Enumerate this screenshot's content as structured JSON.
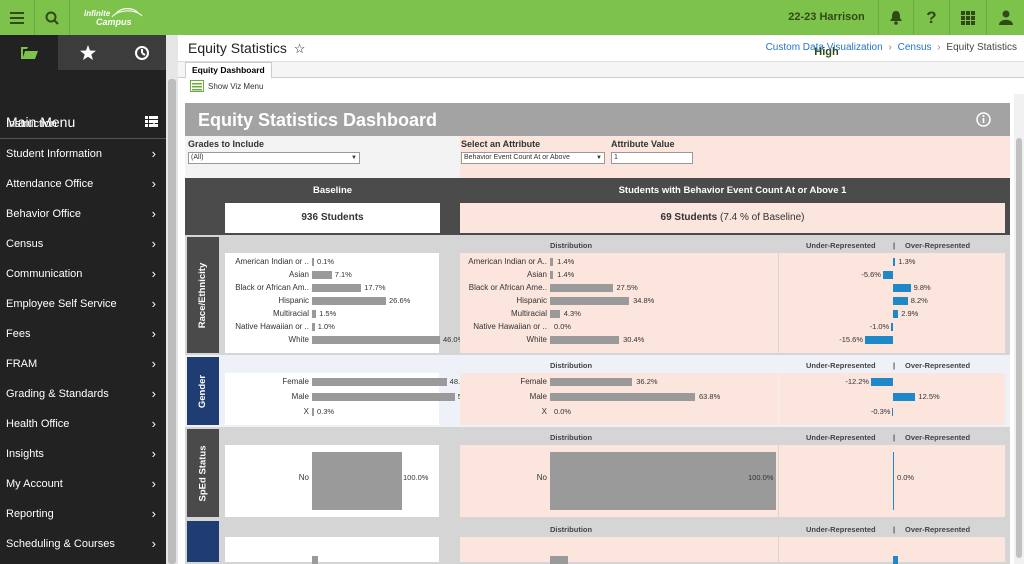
{
  "topbar": {
    "school": "22-23 Harrison High",
    "logo_line1": "Infinite",
    "logo_line2": "Campus"
  },
  "sidebar": {
    "main_menu_label": "Main Menu",
    "items": [
      {
        "label": "Instruction"
      },
      {
        "label": "Student Information"
      },
      {
        "label": "Attendance Office"
      },
      {
        "label": "Behavior Office"
      },
      {
        "label": "Census"
      },
      {
        "label": "Communication"
      },
      {
        "label": "Employee Self Service"
      },
      {
        "label": "Fees"
      },
      {
        "label": "FRAM"
      },
      {
        "label": "Grading & Standards"
      },
      {
        "label": "Health Office"
      },
      {
        "label": "Insights"
      },
      {
        "label": "My Account"
      },
      {
        "label": "Reporting"
      },
      {
        "label": "Scheduling & Courses"
      }
    ]
  },
  "page": {
    "title": "Equity Statistics",
    "breadcrumb": [
      "Custom Data Visualization",
      "Census",
      "Equity Statistics"
    ],
    "tab": "Equity Dashboard",
    "show_viz_menu": "Show Viz Menu"
  },
  "dashboard": {
    "title": "Equity Statistics Dashboard",
    "filters": {
      "grades_label": "Grades to Include",
      "grades_value": "(All)",
      "attribute_label": "Select an Attribute",
      "attribute_value": "Behavior Event Count At or Above",
      "attr_value_label": "Attribute Value",
      "attr_value": "1"
    },
    "baseline_label": "Baseline",
    "baseline_count": "936 Students",
    "subset_label": "Students with Behavior Event Count At or Above 1",
    "subset_count": "69 Students",
    "subset_pct": "(7.4 % of Baseline)",
    "distribution_label": "Distribution",
    "under_label": "Under-Represented",
    "sep": "|",
    "over_label": "Over-Represented",
    "sections": [
      {
        "name": "Race/Ethnicity",
        "color": "#4a4a4a",
        "rows": [
          {
            "label": "American Indian or ..",
            "base": 0.1,
            "base_text": "0.1%",
            "sub_label": "American Indian or A..",
            "sub": 1.4,
            "sub_text": "1.4%",
            "diff": 1.3,
            "diff_text": "1.3%"
          },
          {
            "label": "Asian",
            "base": 7.1,
            "base_text": "7.1%",
            "sub_label": "Asian",
            "sub": 1.4,
            "sub_text": "1.4%",
            "diff": -5.6,
            "diff_text": "-5.6%"
          },
          {
            "label": "Black or African Am..",
            "base": 17.7,
            "base_text": "17.7%",
            "sub_label": "Black or African Ame..",
            "sub": 27.5,
            "sub_text": "27.5%",
            "diff": 9.8,
            "diff_text": "9.8%"
          },
          {
            "label": "Hispanic",
            "base": 26.6,
            "base_text": "26.6%",
            "sub_label": "Hispanic",
            "sub": 34.8,
            "sub_text": "34.8%",
            "diff": 8.2,
            "diff_text": "8.2%"
          },
          {
            "label": "Multiracial",
            "base": 1.5,
            "base_text": "1.5%",
            "sub_label": "Multiracial",
            "sub": 4.3,
            "sub_text": "4.3%",
            "diff": 2.9,
            "diff_text": "2.9%"
          },
          {
            "label": "Native Hawaiian or ..",
            "base": 1.0,
            "base_text": "1.0%",
            "sub_label": "Native Hawaiian or ..",
            "sub": 0.0,
            "sub_text": "0.0%",
            "diff": -1.0,
            "diff_text": "-1.0%"
          },
          {
            "label": "White",
            "base": 46.0,
            "base_text": "46.0%",
            "sub_label": "White",
            "sub": 30.4,
            "sub_text": "30.4%",
            "diff": -15.6,
            "diff_text": "-15.6%"
          }
        ]
      },
      {
        "name": "Gender",
        "color": "#1f3c73",
        "rows": [
          {
            "label": "Female",
            "base": 48.4,
            "base_text": "48.4%",
            "sub_label": "Female",
            "sub": 36.2,
            "sub_text": "36.2%",
            "diff": -12.2,
            "diff_text": "-12.2%"
          },
          {
            "label": "Male",
            "base": 51.3,
            "base_text": "51.3%",
            "sub_label": "Male",
            "sub": 63.8,
            "sub_text": "63.8%",
            "diff": 12.5,
            "diff_text": "12.5%"
          },
          {
            "label": "X",
            "base": 0.3,
            "base_text": "0.3%",
            "sub_label": "X",
            "sub": 0.0,
            "sub_text": "0.0%",
            "diff": -0.3,
            "diff_text": "-0.3%"
          }
        ]
      },
      {
        "name": "SpEd Status",
        "color": "#4a4a4a",
        "rows": [
          {
            "label": "No",
            "base": 100.0,
            "base_text": "100.0%",
            "sub_label": "No",
            "sub": 100.0,
            "sub_text": "100.0%",
            "diff": 0.0,
            "diff_text": "0.0%"
          }
        ]
      },
      {
        "name": "",
        "color": "#1f3c73",
        "rows": [
          {
            "label": "",
            "base": 2.0,
            "base_text": "",
            "sub_label": "",
            "sub": 8.0,
            "sub_text": "",
            "diff": 3.0,
            "diff_text": ""
          }
        ]
      }
    ]
  },
  "colors": {
    "topbar": "#7dc24b",
    "sidebar": "#222222",
    "bar": "#9a9a9a",
    "diverge": "#1e88c8",
    "subset_bg": "#fbe5dc"
  }
}
